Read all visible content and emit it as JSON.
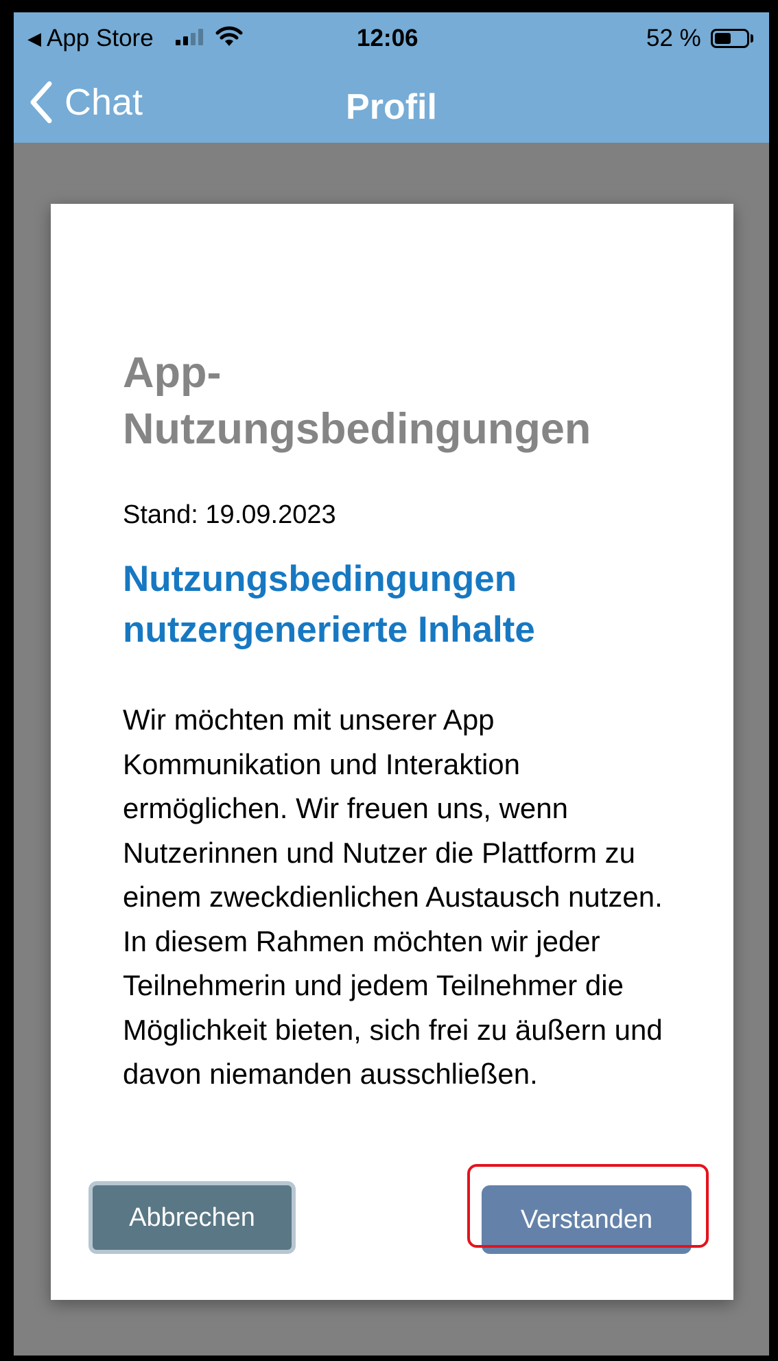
{
  "status_bar": {
    "back_app_label": "App Store",
    "time": "12:06",
    "battery_percent": "52 %",
    "battery_level": 0.52
  },
  "nav": {
    "back_label": "Chat",
    "title": "Profil"
  },
  "dialog": {
    "heading": "App-Nutzungsbedingungen",
    "date": "Stand: 19.09.2023",
    "subheading": "Nutzungsbedingungen nutzergenerierte Inhalte",
    "body": "Wir möchten mit unserer App Kommunikation und Interaktion ermöglichen. Wir freuen uns, wenn Nutzerinnen und Nutzer die Plattform zu einem zweckdienlichen Austausch nutzen. In diesem Rahmen möchten wir jeder Teilnehmerin und jedem Teilnehmer die Möglichkeit bieten, sich frei zu äußern und davon niemanden ausschließen.",
    "cancel_label": "Abbrechen",
    "confirm_label": "Verstanden"
  },
  "colors": {
    "header_bg": "#76acd6",
    "overlay_bg": "#808080",
    "heading_gray": "#858585",
    "subheading_blue": "#1778c2",
    "cancel_bg": "#5a7785",
    "confirm_bg": "#6482a9",
    "highlight_red": "#e4121d"
  },
  "icons": {
    "back": "chevron-left-icon",
    "wifi": "wifi-icon",
    "signal": "cellular-signal-icon",
    "battery": "battery-icon"
  }
}
